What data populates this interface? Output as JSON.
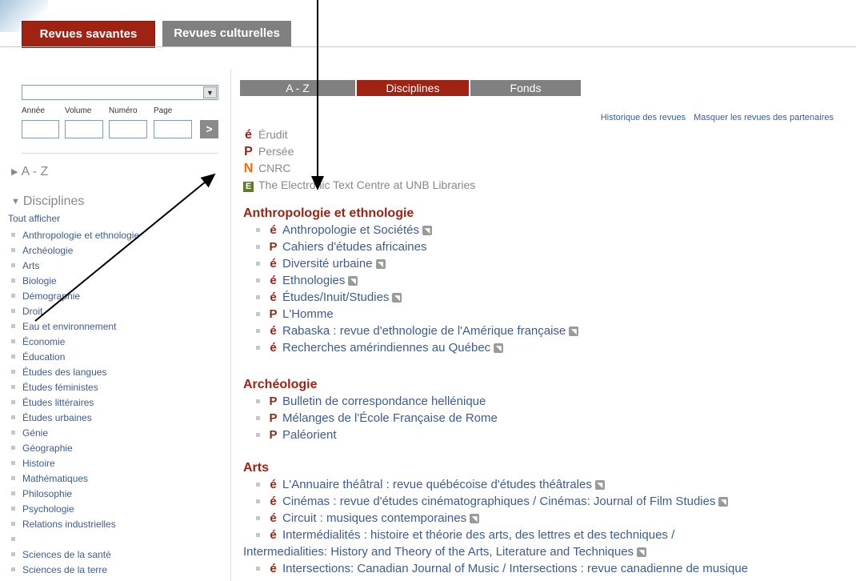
{
  "top_tabs": {
    "scholarly": "Revues savantes",
    "cultural": "Revues culturelles"
  },
  "search": {
    "labels": [
      "Année",
      "Volume",
      "Numéro",
      "Page"
    ],
    "go_glyph": ">"
  },
  "nav": {
    "az": "A - Z",
    "disciplines": "Disciplines",
    "show_all": "Tout afficher",
    "items": [
      "Anthropologie et ethnologie",
      "Archéologie",
      "Arts",
      "Biologie",
      "Démographie",
      "Droit",
      "Eau et environnement",
      "Économie",
      "Éducation",
      "Études des langues",
      "Études féministes",
      "Études littéraires",
      "Études urbaines",
      "Génie",
      "Géographie",
      "Histoire",
      "Mathématiques",
      "Philosophie",
      "Psychologie",
      "Relations industrielles",
      "",
      "Sciences de la santé",
      "Sciences de la terre"
    ]
  },
  "main_tabs": {
    "az": "A - Z",
    "disciplines": "Disciplines",
    "fonds": "Fonds"
  },
  "top_links": {
    "history": "Historique des revues",
    "hide_partners": "Masquer les revues des partenaires"
  },
  "legend": {
    "erudit": "Érudit",
    "persee": "Persée",
    "cnrc": "CNRC",
    "unb": "The Electronic Text Centre at UNB Libraries"
  },
  "sections": {
    "anthro": {
      "title": "Anthropologie et ethnologie",
      "items": [
        "Anthropologie et Sociétés",
        "Cahiers d'études africaines",
        "Diversité urbaine",
        "Ethnologies",
        "Études/Inuit/Studies",
        "L'Homme",
        "Rabaska : revue d'ethnologie de l'Amérique française",
        "Recherches amérindiennes au Québec"
      ]
    },
    "archeo": {
      "title": "Archéologie",
      "items": [
        "Bulletin de correspondance hellénique",
        "Mélanges de l'École Française de Rome",
        "Paléorient"
      ]
    },
    "arts": {
      "title": "Arts",
      "items": [
        "L'Annuaire théâtral : revue québécoise d'études théâtrales",
        "Cinémas : revue d'études cinématographiques / Cinémas: Journal of Film Studies",
        "Circuit : musiques contemporaines",
        "Intermédialités : histoire et théorie des arts, des lettres et des techniques /",
        "Intermedialities: History and Theory of the Arts, Literature and Techniques",
        "Intersections: Canadian Journal of Music / Intersections : revue canadienne de musique"
      ]
    }
  },
  "icons": {
    "erudit": "é",
    "persee": "P",
    "cnrc": "N",
    "unb": "E",
    "rss": "rss-icon"
  }
}
